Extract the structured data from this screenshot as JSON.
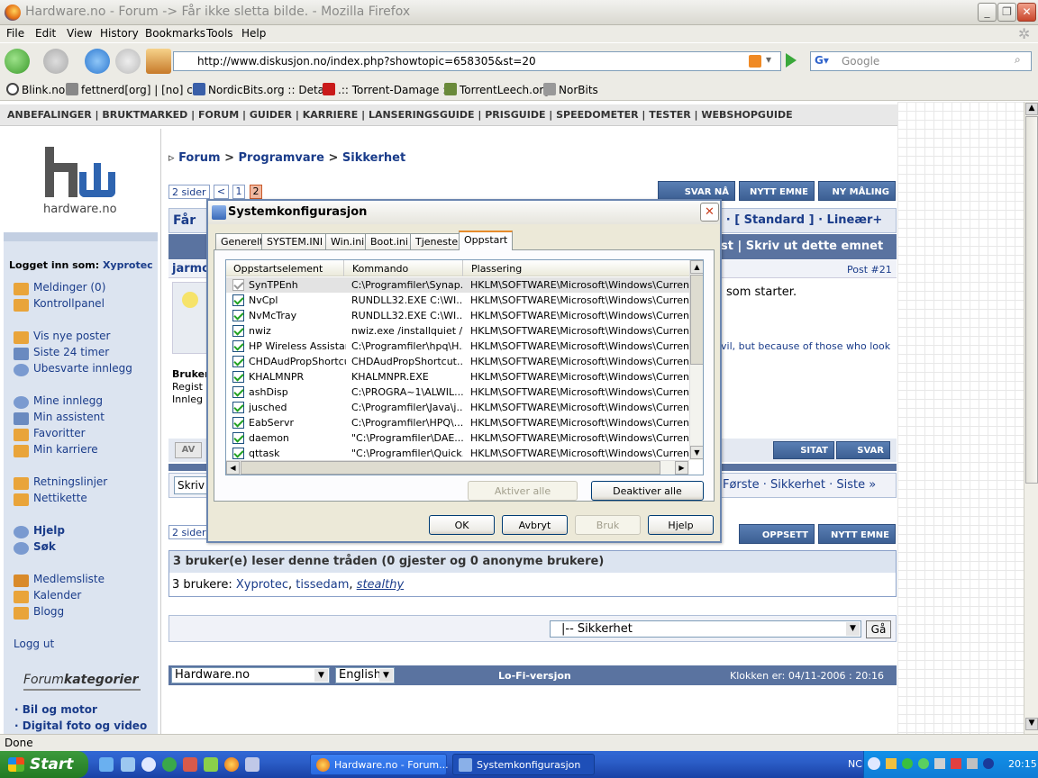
{
  "window": {
    "title": "Hardware.no - Forum -> Får ikke sletta bilde. - Mozilla Firefox"
  },
  "menu": [
    "File",
    "Edit",
    "View",
    "History",
    "Bookmarks",
    "Tools",
    "Help"
  ],
  "navigation": {
    "url": "http://www.diskusjon.no/index.php?showtopic=658305&st=20",
    "search_placeholder": "Google"
  },
  "bookmarks": [
    "Blink.no",
    "fettnerd[org] | [no] c...",
    "NordicBits.org :: Deta...",
    ".:: Torrent-Damage ::.",
    "TorrentLeech.org",
    "NorBits"
  ],
  "site": {
    "topnav": "ANBEFALINGER | BRUKTMARKED | FORUM | GUIDER | KARRIERE | LANSERINGSGUIDE | PRISGUIDE | SPEEDOMETER | TESTER | WEBSHOPGUIDE",
    "logo_text": "hardware.no",
    "breadcrumb": {
      "a": "Forum",
      "b": "Programvare",
      "c": "Sikkerhet",
      "sep": ">"
    },
    "pages": {
      "label": "2 sider",
      "prev": "<",
      "p1": "1",
      "p2": "2"
    },
    "buttons_top": [
      "SVAR NÅ",
      "NYTT EMNE",
      "NY MÅLING"
    ],
    "buttons_bottom": [
      "OPPSETT",
      "NYTT EMNE"
    ],
    "title_partial": "Får",
    "view_modes": "t · [ Standard ] · Lineær+",
    "toolbar_text": "st | Skriv ut dette emnet",
    "post_author_partial": "jarmo",
    "post_number": "Post #21",
    "post_text_partial": "som starter.",
    "signature_partial": "vil, but because of those who look",
    "post_meta": [
      "Bruker",
      "Regist",
      "Innleg"
    ],
    "av_label": "AV",
    "quote_buttons": [
      "SITAT",
      "SVAR"
    ],
    "skriv_partial": "Skriv",
    "nav_links": "Første · Sikkerhet · Siste »",
    "bottom_pages_partial": "2 sider",
    "readers_title": "3 bruker(e) leser denne tråden (0 gjester og 0 anonyme brukere)",
    "readers_label": "3 brukere:",
    "readers": [
      "Xyprotec",
      "tissedam",
      "stealthy"
    ],
    "forum_select": "|-- Sikkerhet",
    "go_button": "Gå",
    "footer_select_site": "Hardware.no",
    "footer_select_lang": "English",
    "lofi": "Lo-Fi-versjon",
    "clock": "Klokken er: 04/11-2006 : 20:16"
  },
  "sidebar": {
    "login_label": "Logget inn som:",
    "login_user": "Xyprotec",
    "items": [
      "Meldinger (0)",
      "Kontrollpanel",
      "Vis nye poster",
      "Siste 24 timer",
      "Ubesvarte innlegg",
      "Mine innlegg",
      "Min assistent",
      "Favoritter",
      "Min karriere",
      "Retningslinjer",
      "Nettikette",
      "Hjelp",
      "Søk",
      "Medlemsliste",
      "Kalender",
      "Blogg",
      "Logg ut"
    ],
    "forumcat_a": "Forum",
    "forumcat_b": "kategorier",
    "cats": [
      "· Bil og motor",
      "· Digital foto og video"
    ]
  },
  "dialog": {
    "title": "Systemkonfigurasjon",
    "tabs": [
      "Generelt",
      "SYSTEM.INI",
      "Win.ini",
      "Boot.ini",
      "Tjenester",
      "Oppstart"
    ],
    "active_tab": "Oppstart",
    "columns": [
      "Oppstartselement",
      "Kommando",
      "Plassering"
    ],
    "rows": [
      {
        "name": "SynTPEnh",
        "cmd": "C:\\Programfiler\\Synap...",
        "loc": "HKLM\\SOFTWARE\\Microsoft\\Windows\\CurrentVer..."
      },
      {
        "name": "NvCpl",
        "cmd": "RUNDLL32.EXE C:\\WI...",
        "loc": "HKLM\\SOFTWARE\\Microsoft\\Windows\\CurrentVer..."
      },
      {
        "name": "NvMcTray",
        "cmd": "RUNDLL32.EXE C:\\WI...",
        "loc": "HKLM\\SOFTWARE\\Microsoft\\Windows\\CurrentVer..."
      },
      {
        "name": "nwiz",
        "cmd": "nwiz.exe /installquiet /...",
        "loc": "HKLM\\SOFTWARE\\Microsoft\\Windows\\CurrentVer..."
      },
      {
        "name": "HP Wireless Assistant",
        "cmd": "C:\\Programfiler\\hpq\\H...",
        "loc": "HKLM\\SOFTWARE\\Microsoft\\Windows\\CurrentVer..."
      },
      {
        "name": "CHDAudPropShortcut",
        "cmd": "CHDAudPropShortcut....",
        "loc": "HKLM\\SOFTWARE\\Microsoft\\Windows\\CurrentVer..."
      },
      {
        "name": "KHALMNPR",
        "cmd": "KHALMNPR.EXE",
        "loc": "HKLM\\SOFTWARE\\Microsoft\\Windows\\CurrentVer..."
      },
      {
        "name": "ashDisp",
        "cmd": "C:\\PROGRA~1\\ALWIL...",
        "loc": "HKLM\\SOFTWARE\\Microsoft\\Windows\\CurrentVer..."
      },
      {
        "name": "jusched",
        "cmd": "C:\\Programfiler\\Java\\j...",
        "loc": "HKLM\\SOFTWARE\\Microsoft\\Windows\\CurrentVer..."
      },
      {
        "name": "EabServr",
        "cmd": "C:\\Programfiler\\HPQ\\...",
        "loc": "HKLM\\SOFTWARE\\Microsoft\\Windows\\CurrentVer..."
      },
      {
        "name": "daemon",
        "cmd": "\"C:\\Programfiler\\DAE...",
        "loc": "HKLM\\SOFTWARE\\Microsoft\\Windows\\CurrentVer..."
      },
      {
        "name": "qttask",
        "cmd": "\"C:\\Programfiler\\Quick...",
        "loc": "HKLM\\SOFTWARE\\Microsoft\\Windows\\CurrentVer..."
      }
    ],
    "enable_all": "Aktiver alle",
    "disable_all": "Deaktiver alle",
    "ok": "OK",
    "cancel": "Avbryt",
    "apply": "Bruk",
    "help": "Hjelp"
  },
  "status": "Done",
  "taskbar": {
    "start": "Start",
    "tasks": [
      "Hardware.no - Forum...",
      "Systemkonfigurasjon"
    ],
    "lang": "NC",
    "time": "20:15"
  }
}
